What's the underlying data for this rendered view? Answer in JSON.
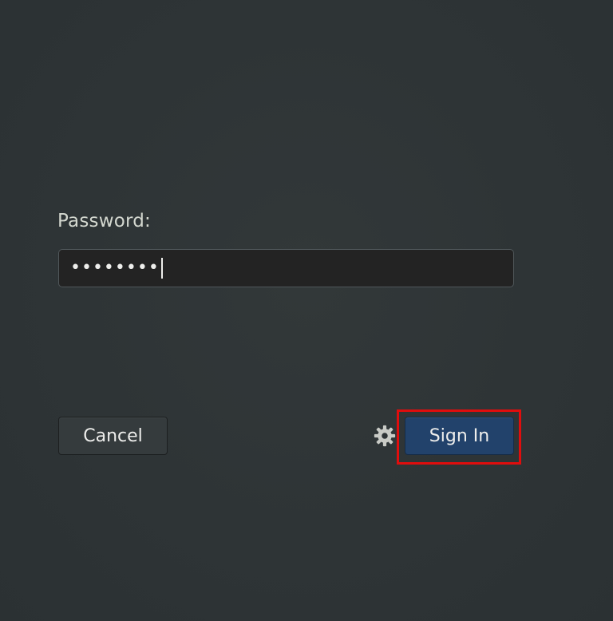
{
  "login": {
    "password_label": "Password:",
    "password_masked": "••••••••",
    "cancel_label": "Cancel",
    "signin_label": "Sign In"
  },
  "icons": {
    "session": "gear-icon"
  },
  "colors": {
    "background": "#2e3436",
    "field_background": "#232323",
    "primary_button": "#22426b",
    "highlight": "#e00d0d"
  }
}
